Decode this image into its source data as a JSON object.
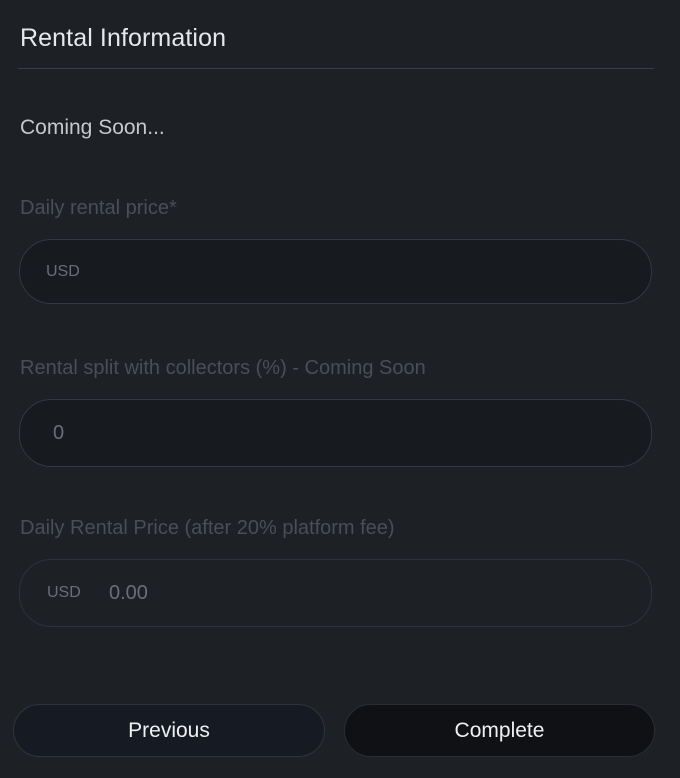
{
  "header": {
    "title": "Rental Information"
  },
  "notice": "Coming Soon...",
  "fields": {
    "daily_price": {
      "label": "Daily rental price*",
      "placeholder": "USD",
      "value": ""
    },
    "split": {
      "label": "Rental split with collectors (%) - Coming Soon",
      "value": "0"
    },
    "after_fee": {
      "label": "Daily Rental Price (after 20% platform fee)",
      "unit": "USD",
      "value": "0.00"
    }
  },
  "buttons": {
    "previous": "Previous",
    "complete": "Complete"
  }
}
